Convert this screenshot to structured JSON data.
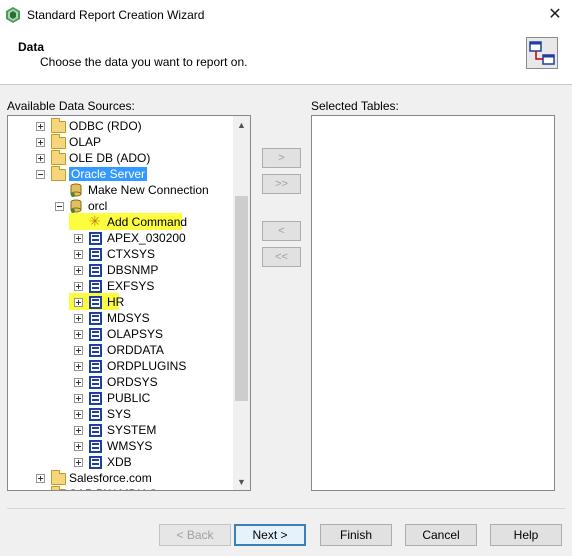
{
  "window": {
    "title": "Standard Report Creation Wizard",
    "close_glyph": "✕"
  },
  "header": {
    "title": "Data",
    "subtitle": "Choose the data you want to report on."
  },
  "left_panel": {
    "label": "Available Data Sources:"
  },
  "right_panel": {
    "label": "Selected Tables:"
  },
  "tree": [
    {
      "label": "ODBC (RDO)",
      "icon": "folder-icon",
      "expander": "plus"
    },
    {
      "label": "OLAP",
      "icon": "folder-icon",
      "expander": "plus"
    },
    {
      "label": "OLE DB (ADO)",
      "icon": "folder-icon",
      "expander": "plus"
    },
    {
      "label": "Oracle Server",
      "icon": "folder-icon",
      "expander": "minus",
      "selected": true
    },
    {
      "label": "Make New Connection",
      "icon": "new-connection-icon"
    },
    {
      "label": "orcl",
      "icon": "database-connection-icon",
      "expander": "minus"
    },
    {
      "label": "Add Command",
      "icon": "add-command-icon",
      "highlight": true
    },
    {
      "label": "APEX_030200",
      "icon": "schema-icon",
      "expander": "plus"
    },
    {
      "label": "CTXSYS",
      "icon": "schema-icon",
      "expander": "plus"
    },
    {
      "label": "DBSNMP",
      "icon": "schema-icon",
      "expander": "plus"
    },
    {
      "label": "EXFSYS",
      "icon": "schema-icon",
      "expander": "plus"
    },
    {
      "label": "HR",
      "icon": "schema-icon",
      "expander": "plus",
      "highlight": true
    },
    {
      "label": "MDSYS",
      "icon": "schema-icon",
      "expander": "plus"
    },
    {
      "label": "OLAPSYS",
      "icon": "schema-icon",
      "expander": "plus"
    },
    {
      "label": "ORDDATA",
      "icon": "schema-icon",
      "expander": "plus"
    },
    {
      "label": "ORDPLUGINS",
      "icon": "schema-icon",
      "expander": "plus"
    },
    {
      "label": "ORDSYS",
      "icon": "schema-icon",
      "expander": "plus"
    },
    {
      "label": "PUBLIC",
      "icon": "schema-icon",
      "expander": "plus"
    },
    {
      "label": "SYS",
      "icon": "schema-icon",
      "expander": "plus"
    },
    {
      "label": "SYSTEM",
      "icon": "schema-icon",
      "expander": "plus"
    },
    {
      "label": "WMSYS",
      "icon": "schema-icon",
      "expander": "plus"
    },
    {
      "label": "XDB",
      "icon": "schema-icon",
      "expander": "plus"
    },
    {
      "label": "Salesforce.com",
      "icon": "folder-icon",
      "expander": "plus"
    },
    {
      "label": "SAP BW MDX Query",
      "icon": "folder-icon",
      "expander": "plus"
    }
  ],
  "transfer_buttons": {
    "add": ">",
    "add_all": ">>",
    "remove": "<",
    "remove_all": "<<"
  },
  "footer": {
    "back": "< Back",
    "next": "Next >",
    "finish": "Finish",
    "cancel": "Cancel",
    "help": "Help"
  },
  "colors": {
    "selection": "#3399ff",
    "highlight": "#fdfd40",
    "schema_icon": "#1f3f9e"
  }
}
